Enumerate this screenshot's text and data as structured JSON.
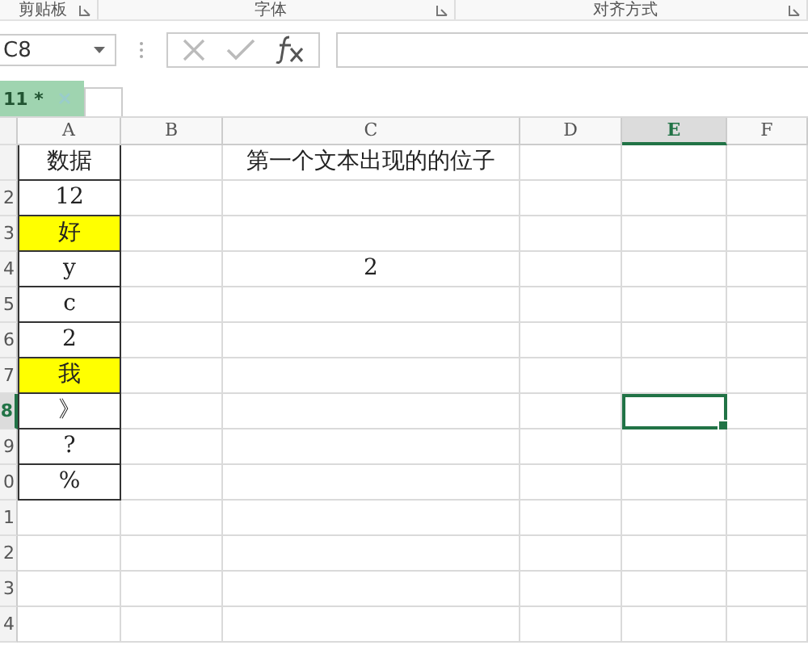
{
  "ribbon_groups": [
    {
      "label": "剪贴板"
    },
    {
      "label": "字体"
    },
    {
      "label": "对齐方式"
    }
  ],
  "name_box": {
    "value": "C8"
  },
  "sheet_tabs": [
    {
      "label": "11 *",
      "selected": true
    }
  ],
  "columns": [
    {
      "label": "A",
      "selected": false
    },
    {
      "label": "B",
      "selected": false
    },
    {
      "label": "C",
      "selected": false
    },
    {
      "label": "D",
      "selected": false
    },
    {
      "label": "E",
      "selected": true
    },
    {
      "label": "F",
      "selected": false
    }
  ],
  "rows": [
    {
      "selected": false,
      "a": {
        "text": "数据",
        "highlighted": false
      },
      "c": {
        "text": "第一个文本出现的的位子"
      }
    },
    {
      "header": "2",
      "selected": false,
      "a": {
        "text": "12",
        "highlighted": false
      }
    },
    {
      "header": "3",
      "selected": false,
      "a": {
        "text": "好",
        "highlighted": true
      }
    },
    {
      "header": "4",
      "selected": false,
      "a": {
        "text": "y",
        "highlighted": false
      },
      "c": {
        "text": "2"
      }
    },
    {
      "header": "5",
      "selected": false,
      "a": {
        "text": "c",
        "highlighted": false
      }
    },
    {
      "header": "6",
      "selected": false,
      "a": {
        "text": "2",
        "highlighted": false
      }
    },
    {
      "header": "7",
      "selected": false,
      "a": {
        "text": "我",
        "highlighted": true
      }
    },
    {
      "header": "8",
      "selected": true,
      "a": {
        "text": "》",
        "highlighted": false
      }
    },
    {
      "header": "9",
      "selected": false,
      "a": {
        "text": "?",
        "highlighted": false
      }
    },
    {
      "header": "0",
      "selected": false,
      "a": {
        "text": "%",
        "highlighted": false
      }
    },
    {
      "header": "1",
      "selected": false
    },
    {
      "header": "2",
      "selected": false
    },
    {
      "header": "3",
      "selected": false
    },
    {
      "header": "4",
      "selected": false
    }
  ]
}
